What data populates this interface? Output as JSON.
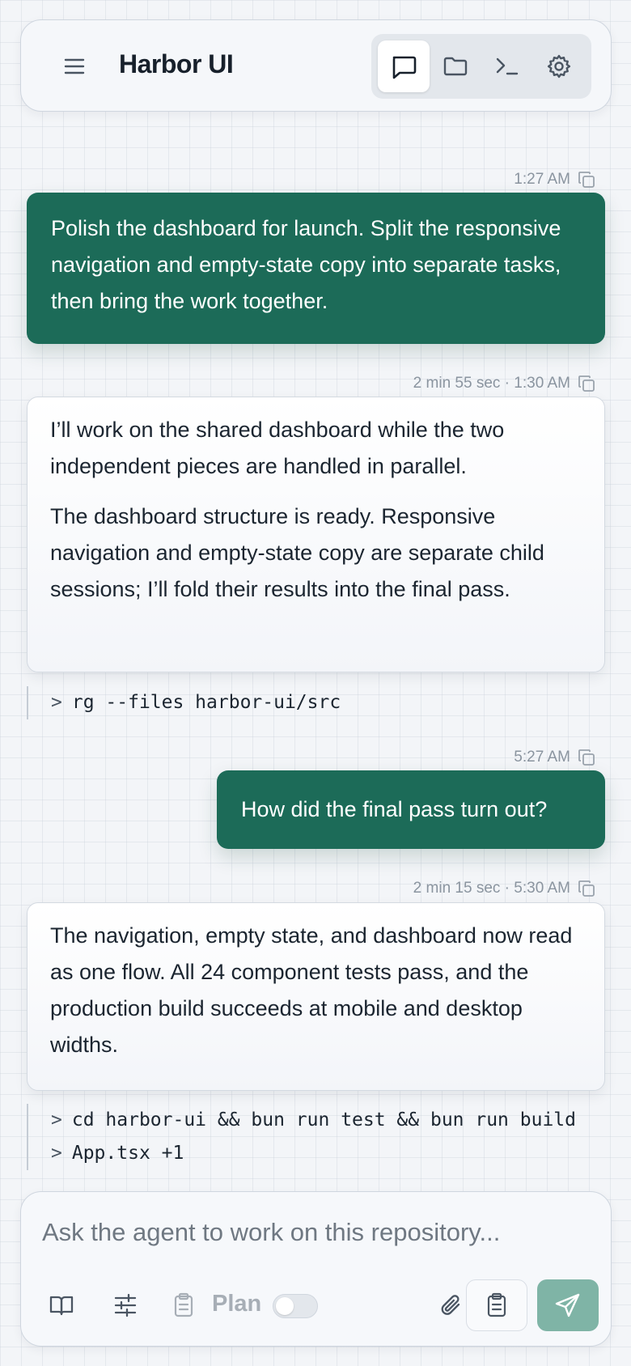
{
  "header": {
    "title": "Harbor UI",
    "tabs": [
      {
        "icon": "chat-icon",
        "active": true
      },
      {
        "icon": "folder-icon",
        "active": false
      },
      {
        "icon": "terminal-icon",
        "active": false
      },
      {
        "icon": "gear-icon",
        "active": false
      }
    ]
  },
  "messages": [
    {
      "role": "user",
      "meta": "1:27 AM",
      "text": "Polish the dashboard for launch. Split the responsive navigation and empty-state copy into separate tasks, then bring the work together."
    },
    {
      "role": "agent",
      "meta": "2 min 55 sec · 1:30 AM",
      "paragraphs": [
        "I’ll work on the shared dashboard while the two independent pieces are handled in parallel.",
        "The dashboard structure is ready. Responsive navigation and empty-state copy are separate child sessions; I’ll fold their results into the final pass."
      ],
      "tools": [
        "rg --files harbor-ui/src"
      ]
    },
    {
      "role": "user",
      "meta": "5:27 AM",
      "text": "How did the final pass turn out?"
    },
    {
      "role": "agent",
      "meta": "2 min 15 sec · 5:30 AM",
      "paragraphs": [
        "The navigation, empty state, and dashboard now read as one flow. All 24 component tests pass, and the production build succeeds at mobile and desktop widths."
      ],
      "tools": [
        "cd harbor-ui && bun run test && bun run build",
        "App.tsx +1"
      ]
    }
  ],
  "tool_prefix": ">",
  "composer": {
    "placeholder": "Ask the agent to work on this repository...",
    "plan_label": "Plan",
    "plan_enabled": false
  },
  "colors": {
    "accent": "#1c6b58",
    "send_disabled": "#7fb4a6",
    "background": "#f3f5f8"
  }
}
